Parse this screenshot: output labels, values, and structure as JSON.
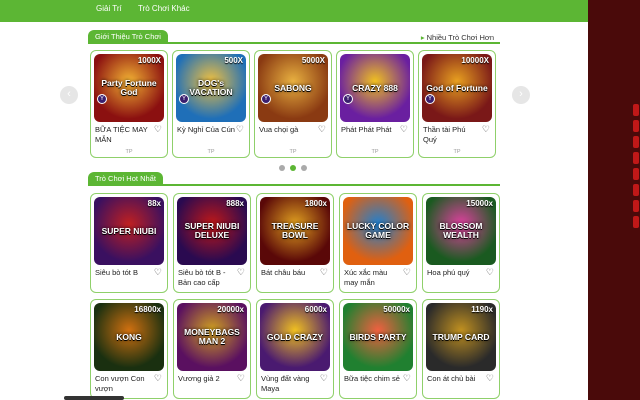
{
  "nav": {
    "items": [
      "Giải Trí",
      "Trò Chơi Khác"
    ]
  },
  "intro_section": {
    "tag": "Giới Thiệu Trò Chơi",
    "more_label": "Nhiều Trò Chơi Hơn",
    "cards": [
      {
        "name": "BỮA TIỆC MAY MẮN",
        "provider": "TP",
        "art": "Party Fortune God",
        "badge": "1000X",
        "colors": [
          "#8b1010",
          "#f2b233"
        ]
      },
      {
        "name": "Kỳ Nghỉ Của Cún",
        "provider": "TP",
        "art": "DOG's VACATION",
        "badge": "500X",
        "colors": [
          "#1f6fb8",
          "#f0c040"
        ]
      },
      {
        "name": "Vua chọi gà",
        "provider": "TP",
        "art": "SABONG",
        "badge": "5000X",
        "colors": [
          "#8a3a12",
          "#e8b040"
        ]
      },
      {
        "name": "Phát Phát Phát",
        "provider": "TP",
        "art": "CRAZY 888",
        "badge": "",
        "colors": [
          "#6a1fa0",
          "#f0c020"
        ]
      },
      {
        "name": "Thần tài Phú Quý",
        "provider": "TP",
        "art": "God of Fortune",
        "badge": "10000X",
        "colors": [
          "#7a1818",
          "#e8a020"
        ]
      }
    ]
  },
  "hot_section": {
    "tag": "Trò Chơi Hot Nhất",
    "cards": [
      {
        "name": "Siêu bò tót B",
        "art": "SUPER NIUBI",
        "badge": "88x",
        "colors": [
          "#3a1060",
          "#c02020"
        ]
      },
      {
        "name": "Siêu bò tót B - Bản cao cấp",
        "art": "SUPER NIUBI DELUXE",
        "badge": "888x",
        "colors": [
          "#2a0a50",
          "#c01818"
        ]
      },
      {
        "name": "Bát châu báu",
        "art": "TREASURE BOWL",
        "badge": "1800x",
        "colors": [
          "#5a0808",
          "#e0a020"
        ]
      },
      {
        "name": "Xúc xắc màu may mắn",
        "art": "LUCKY COLOR GAME",
        "badge": "",
        "colors": [
          "#e06010",
          "#2080d0"
        ]
      },
      {
        "name": "Hoa phú quý",
        "art": "BLOSSOM WEALTH",
        "badge": "15000x",
        "colors": [
          "#1a5a20",
          "#e040a0"
        ]
      },
      {
        "name": "Con vượn Con vượn",
        "art": "KONG",
        "badge": "16800x",
        "colors": [
          "#1a3010",
          "#d07010"
        ]
      },
      {
        "name": "Vương giả 2",
        "art": "MONEYBAGS MAN 2",
        "badge": "20000x",
        "colors": [
          "#5a1060",
          "#d0a020"
        ]
      },
      {
        "name": "Vùng đất vàng Maya",
        "art": "GOLD CRAZY",
        "badge": "6000x",
        "colors": [
          "#4a1a70",
          "#f0c020"
        ]
      },
      {
        "name": "Bữa tiệc chim sẻ",
        "art": "BIRDS PARTY",
        "badge": "50000x",
        "colors": [
          "#208030",
          "#f06040"
        ]
      },
      {
        "name": "Con át chủ bài",
        "art": "TRUMP CARD",
        "badge": "1190x",
        "colors": [
          "#2a2a2a",
          "#c09020"
        ]
      }
    ]
  },
  "carousel": {
    "dots": 3,
    "active": 1
  }
}
